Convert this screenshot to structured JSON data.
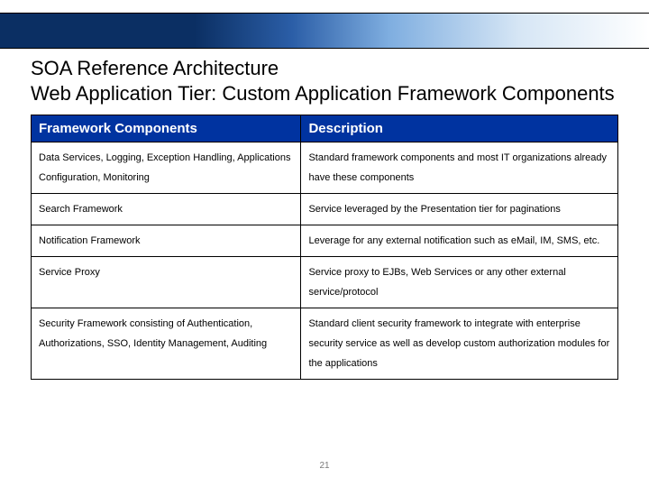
{
  "title": "SOA Reference Architecture\nWeb Application Tier: Custom Application Framework Components",
  "table": {
    "headers": {
      "component": "Framework Components",
      "description": "Description"
    },
    "rows": [
      {
        "component": "Data Services, Logging, Exception Handling, Applications Configuration, Monitoring",
        "description": "Standard framework components and most IT organizations already have these components"
      },
      {
        "component": "Search Framework",
        "description": "Service leveraged by the Presentation tier for paginations"
      },
      {
        "component": "Notification Framework",
        "description": "Leverage for any external notification such as eMail, IM, SMS, etc."
      },
      {
        "component": "Service Proxy",
        "description": "Service proxy to EJBs, Web Services or any other external service/protocol"
      },
      {
        "component": "Security Framework consisting of Authentication, Authorizations, SSO, Identity Management, Auditing",
        "description": "Standard client security framework to integrate with enterprise security service as well as develop custom authorization modules for the applications"
      }
    ]
  },
  "page_number": "21"
}
